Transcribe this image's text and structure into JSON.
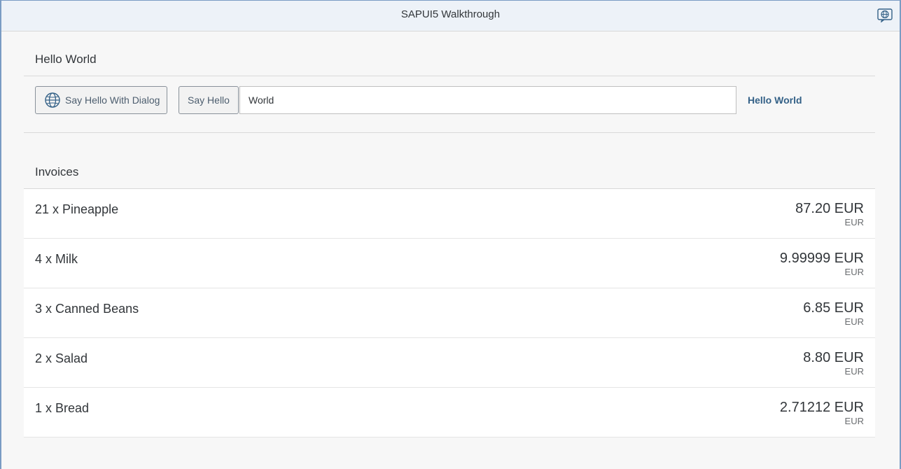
{
  "app": {
    "title": "SAPUI5 Walkthrough"
  },
  "hello_panel": {
    "title": "Hello World",
    "dialog_button_label": "Say Hello With Dialog",
    "say_hello_label": "Say Hello",
    "name_input_value": "World",
    "greeting_text": "Hello World"
  },
  "invoices": {
    "title": "Invoices",
    "items": [
      {
        "name": "21 x Pineapple",
        "amount": "87.20 EUR",
        "currency": "EUR"
      },
      {
        "name": "4 x Milk",
        "amount": "9.99999 EUR",
        "currency": "EUR"
      },
      {
        "name": "3 x Canned Beans",
        "amount": "6.85 EUR",
        "currency": "EUR"
      },
      {
        "name": "2 x Salad",
        "amount": "8.80 EUR",
        "currency": "EUR"
      },
      {
        "name": "1 x Bread",
        "amount": "2.71212 EUR",
        "currency": "EUR"
      }
    ]
  },
  "icons": {
    "shell_action": "globe-icon",
    "dialog_button": "globe-icon"
  },
  "colors": {
    "accent": "#346187",
    "shell_bg": "#edf2f8",
    "frame_border": "#7a9cc4"
  }
}
